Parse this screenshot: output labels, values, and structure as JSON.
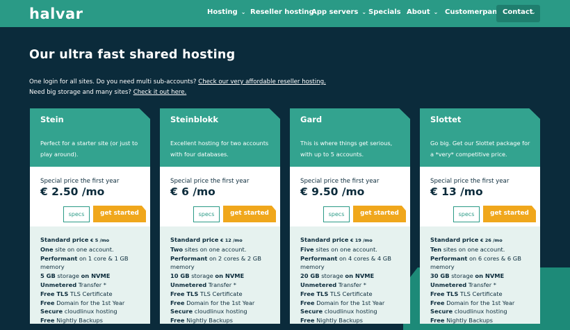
{
  "nav": {
    "logo": "halvar",
    "items": [
      {
        "label": "Hosting",
        "dropdown": true
      },
      {
        "label": "Reseller hosting",
        "dropdown": false
      },
      {
        "label": "App servers",
        "dropdown": true
      },
      {
        "label": "Specials",
        "dropdown": false
      },
      {
        "label": "About",
        "dropdown": true
      },
      {
        "label": "Customerpanel",
        "dropdown": false
      }
    ],
    "contact_label": "Contact"
  },
  "page": {
    "title": "Our ultra fast shared hosting",
    "intro1_text": "One login for all sites. Do you need multi sub-accounts? ",
    "intro1_link": "Check our very affordable reseller hosting.",
    "intro2_text": "Need big storage and many sites? ",
    "intro2_link": "Check it out here."
  },
  "colors": {
    "nav_bg": "#2a9a86",
    "page_bg": "#0b2b3b",
    "card_head": "#33a38f",
    "cta": "#f0a71c",
    "feature_bg": "#e6f2ef"
  },
  "plans": [
    {
      "name": "Stein",
      "description": "Perfect for a starter site (or just to play around).",
      "price_label": "Special price the first year",
      "price": "€ 2.50 /mo",
      "specs_label": "specs",
      "cta_label": "get started",
      "standard_price": "€ 5 /mo",
      "sites_bold": "One",
      "sites_rest": " site on one account.",
      "cpu": " on 1 core & 1 GB memory",
      "storage_bold": "5 GB",
      "transfer": " Transfer *",
      "tls": " TLS Certificate",
      "domain": " Domain for the 1st Year",
      "hosting": " cloudlinux hosting",
      "backups": " Nightly Backups"
    },
    {
      "name": "Steinblokk",
      "description": "Excellent hosting for two accounts with four databases.",
      "price_label": "Special price the first year",
      "price": "€ 6 /mo",
      "specs_label": "specs",
      "cta_label": "get started",
      "standard_price": "€ 12 /mo",
      "sites_bold": "Two",
      "sites_rest": " sites on one account.",
      "cpu": " on 2 cores & 2 GB memory",
      "storage_bold": "10 GB",
      "transfer": " Transfer *",
      "tls": " TLS Certificate",
      "domain": " Domain for the 1st Year",
      "hosting": " cloudlinux hosting",
      "backups": " Nightly Backups"
    },
    {
      "name": "Gard",
      "description": "This is where things get serious, with up to 5 accounts.",
      "price_label": "Special price the first year",
      "price": "€ 9.50 /mo",
      "specs_label": "specs",
      "cta_label": "get started",
      "standard_price": "€ 19 /mo",
      "sites_bold": "Five",
      "sites_rest": " sites on one account.",
      "cpu": " on 4 cores & 4 GB memory",
      "storage_bold": "20 GB",
      "transfer": " Transfer *",
      "tls": " TLS Certificate",
      "domain": " Domain for the 1st Year",
      "hosting": " cloudlinux hosting",
      "backups": " Nightly Backups"
    },
    {
      "name": "Slottet",
      "description": "Go big. Get our Slottet package for a *very* competitive price.",
      "price_label": "Special price the first year",
      "price": "€ 13 /mo",
      "specs_label": "specs",
      "cta_label": "get started",
      "standard_price": "€ 26 /mo",
      "sites_bold": "Ten",
      "sites_rest": " sites on one account.",
      "cpu": " on 6 cores & 6 GB memory",
      "storage_bold": "30 GB",
      "transfer": " Transfer *",
      "tls": " TLS Certificate",
      "domain": " Domain for the 1st Year",
      "hosting": " cloudlinux hosting",
      "backups": " Nightly Backups"
    }
  ],
  "feature_labels": {
    "standard_price": "Standard price",
    "performant": "Performant",
    "storage_suffix": " storage ",
    "on_nvme": "on NVME",
    "unmetered": "Unmetered",
    "free": "Free",
    "secure": "Secure",
    "tls_free": "Free TLS"
  }
}
